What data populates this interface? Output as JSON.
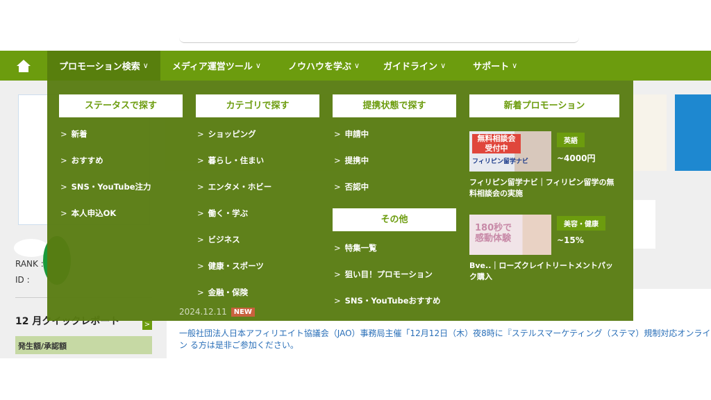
{
  "nav": {
    "home_icon": "home-icon",
    "items": [
      {
        "label": "プロモーション検索"
      },
      {
        "label": "メディア運営ツール"
      },
      {
        "label": "ノウハウを学ぶ"
      },
      {
        "label": "ガイドライン"
      },
      {
        "label": "サポート"
      }
    ],
    "chevron": "∨"
  },
  "mega_menu": {
    "status": {
      "title": "ステータスで探す",
      "links": [
        "新着",
        "おすすめ",
        "SNS・YouTube注力",
        "本人申込OK"
      ]
    },
    "category": {
      "title": "カテゴリで探す",
      "links": [
        "ショッピング",
        "暮らし・住まい",
        "エンタメ・ホビー",
        "働く・学ぶ",
        "ビジネス",
        "健康・スポーツ",
        "金融・保険"
      ]
    },
    "partnership": {
      "title": "提携状態で探す",
      "links": [
        "申請中",
        "提携中",
        "否認中"
      ]
    },
    "other": {
      "title": "その他",
      "links": [
        "特集一覧",
        "狙い目！プロモーション",
        "SNS・YouTubeおすすめ"
      ]
    },
    "new_promos": {
      "title": "新着プロモーション",
      "items": [
        {
          "tag": "英語",
          "reward": "~4000円",
          "title": "フィリピン留学ナビ｜フィリピン留学の無料相談会の実施",
          "image_text": [
            "無料相談会",
            "受付中",
            "フィリピン留学ナビ"
          ]
        },
        {
          "tag": "美容・健康",
          "reward": "~15%",
          "title": "Bve..｜ローズクレイトリートメントパック購入",
          "image_text": [
            "180秒で",
            "感動体験"
          ]
        }
      ]
    }
  },
  "sidebar": {
    "rank_label": "RANK :",
    "id_label": "ID :",
    "quick_report_title": "12 月クイックレポート",
    "amount_header": "発生額/承認額"
  },
  "news": {
    "date": "2024.12.11",
    "badge": "NEW",
    "text": "一般社団法人日本アフィリエイト協議会（JAO）事務局主催「12月12日（木）夜8時に『ステルスマーケティング（ステマ）規制対応オンライン る方は是非ご参加ください。"
  },
  "colors": {
    "nav": "#6c9c0e",
    "nav_active": "#587f0d",
    "menu_overlay": "#587c12",
    "link": "#2a6fb8"
  }
}
